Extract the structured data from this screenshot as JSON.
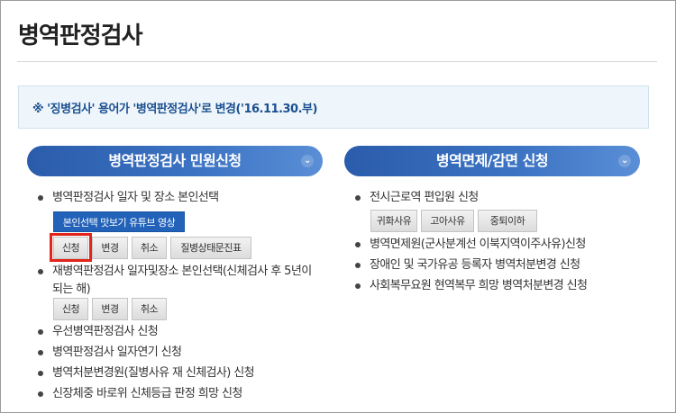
{
  "page": {
    "title": "병역판정검사"
  },
  "notice": {
    "text": "※ '징병검사' 용어가 '병역판정검사'로 변경('16.11.30.부)"
  },
  "left_section": {
    "header": "병역판정검사 민원신청",
    "items": [
      {
        "label": "병역판정검사 일자 및 장소 본인선택",
        "video_button": "본인선택 맛보기 유튜브 영상",
        "buttons": [
          "신청",
          "변경",
          "취소",
          "질병상태문진표"
        ]
      },
      {
        "label_line1": "재병역판정검사 일자및장소 본인선택(신체검사 후 5년이",
        "label_line2": "되는 해)",
        "buttons": [
          "신청",
          "변경",
          "취소"
        ]
      },
      {
        "label": "우선병역판정검사 신청"
      },
      {
        "label": "병역판정검사 일자연기 신청"
      },
      {
        "label": "병역처분변경원(질병사유 재 신체검사) 신청"
      },
      {
        "label": "신장체중 바로위 신체등급 판정 희망 신청"
      }
    ]
  },
  "right_section": {
    "header": "병역면제/감면 신청",
    "items": [
      {
        "label": "전시근로역 편입원 신청",
        "buttons": [
          "귀화사유",
          "고아사유",
          "중퇴이하"
        ]
      },
      {
        "label": "병역면제원(군사분계선 이북지역이주사유)신청"
      },
      {
        "label": "장애인 및 국가유공 등록자 병역처분변경 신청"
      },
      {
        "label": "사회복무요원 현역복무 희망 병역처분변경 신청"
      }
    ]
  },
  "icons": {
    "chevron": "chevron-down-icon"
  },
  "colors": {
    "accent": "#2a5cab",
    "highlight": "#e2241b",
    "notice_text": "#1b4f8f"
  }
}
